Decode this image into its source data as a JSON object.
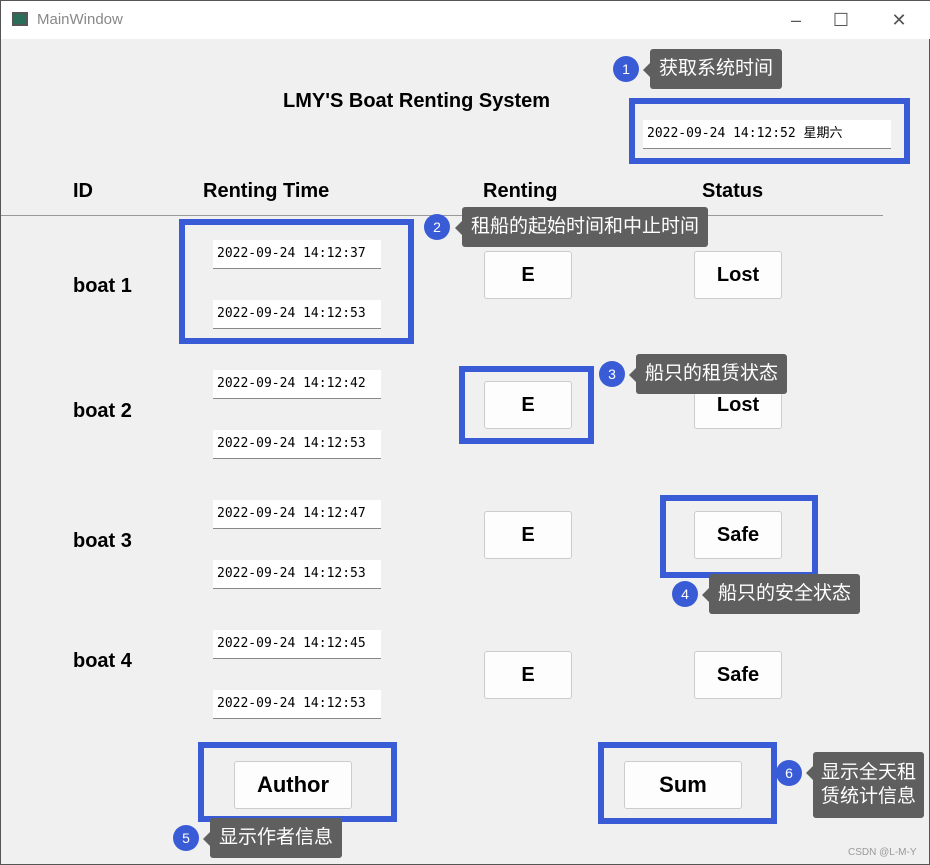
{
  "window": {
    "title": "MainWindow",
    "minimize": "–",
    "maximize": "☐",
    "close": "✕"
  },
  "app_title": "LMY'S Boat Renting System",
  "system_time": "2022-09-24 14:12:52 星期六",
  "headers": {
    "id": "ID",
    "renting_time": "Renting Time",
    "renting": "Renting",
    "status": "Status"
  },
  "boats": [
    {
      "id": "boat 1",
      "start": "2022-09-24 14:12:37",
      "end": "2022-09-24 14:12:53",
      "renting": "E",
      "status": "Lost"
    },
    {
      "id": "boat 2",
      "start": "2022-09-24 14:12:42",
      "end": "2022-09-24 14:12:53",
      "renting": "E",
      "status": "Lost"
    },
    {
      "id": "boat 3",
      "start": "2022-09-24 14:12:47",
      "end": "2022-09-24 14:12:53",
      "renting": "E",
      "status": "Safe"
    },
    {
      "id": "boat 4",
      "start": "2022-09-24 14:12:45",
      "end": "2022-09-24 14:12:53",
      "renting": "E",
      "status": "Safe"
    }
  ],
  "buttons": {
    "author": "Author",
    "sum": "Sum"
  },
  "annotations": [
    {
      "n": "1",
      "text": "获取系统时间"
    },
    {
      "n": "2",
      "text": "租船的起始时间和中止时间"
    },
    {
      "n": "3",
      "text": "船只的租赁状态"
    },
    {
      "n": "4",
      "text": "船只的安全状态"
    },
    {
      "n": "5",
      "text": "显示作者信息"
    },
    {
      "n": "6",
      "text": "显示全天租",
      "text2": "赁统计信息"
    }
  ],
  "watermark": "CSDN @L-M-Y",
  "colors": {
    "highlight": "#3a5bd6",
    "tooltip": "#5f5f5f",
    "background": "#f0f0f0"
  }
}
